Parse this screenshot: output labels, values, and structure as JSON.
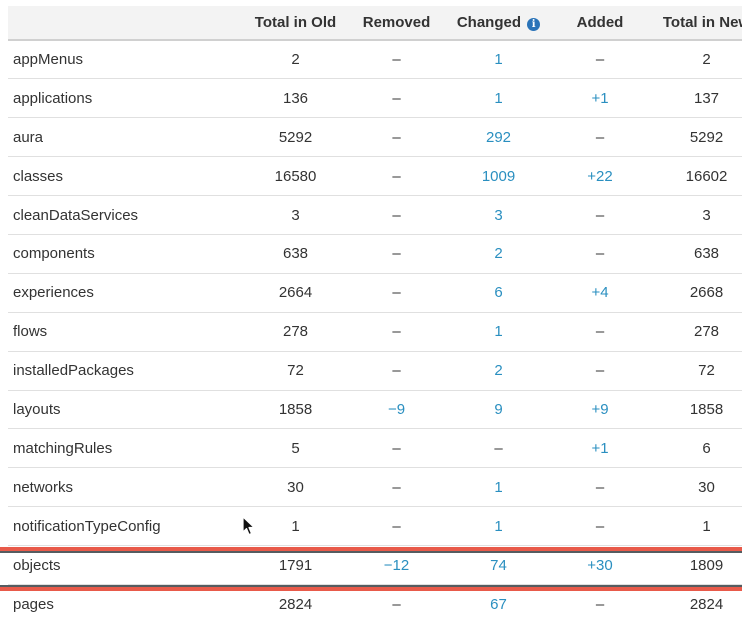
{
  "table": {
    "headers": {
      "name": "",
      "total_old": "Total in Old",
      "removed": "Removed",
      "changed": "Changed",
      "added": "Added",
      "total_new": "Total in New"
    },
    "rows": [
      {
        "name": "appMenus",
        "total_old": "2",
        "removed": "–",
        "changed": "1",
        "added": "–",
        "total_new": "2"
      },
      {
        "name": "applications",
        "total_old": "136",
        "removed": "–",
        "changed": "1",
        "added": "+1",
        "total_new": "137"
      },
      {
        "name": "aura",
        "total_old": "5292",
        "removed": "–",
        "changed": "292",
        "added": "–",
        "total_new": "5292"
      },
      {
        "name": "classes",
        "total_old": "16580",
        "removed": "–",
        "changed": "1009",
        "added": "+22",
        "total_new": "16602"
      },
      {
        "name": "cleanDataServices",
        "total_old": "3",
        "removed": "–",
        "changed": "3",
        "added": "–",
        "total_new": "3"
      },
      {
        "name": "components",
        "total_old": "638",
        "removed": "–",
        "changed": "2",
        "added": "–",
        "total_new": "638"
      },
      {
        "name": "experiences",
        "total_old": "2664",
        "removed": "–",
        "changed": "6",
        "added": "+4",
        "total_new": "2668"
      },
      {
        "name": "flows",
        "total_old": "278",
        "removed": "–",
        "changed": "1",
        "added": "–",
        "total_new": "278"
      },
      {
        "name": "installedPackages",
        "total_old": "72",
        "removed": "–",
        "changed": "2",
        "added": "–",
        "total_new": "72"
      },
      {
        "name": "layouts",
        "total_old": "1858",
        "removed": "−9",
        "changed": "9",
        "added": "+9",
        "total_new": "1858"
      },
      {
        "name": "matchingRules",
        "total_old": "5",
        "removed": "–",
        "changed": "–",
        "added": "+1",
        "total_new": "6"
      },
      {
        "name": "networks",
        "total_old": "30",
        "removed": "–",
        "changed": "1",
        "added": "–",
        "total_new": "30"
      },
      {
        "name": "notificationTypeConfig",
        "total_old": "1",
        "removed": "–",
        "changed": "1",
        "added": "–",
        "total_new": "1"
      },
      {
        "name": "objects",
        "total_old": "1791",
        "removed": "−12",
        "changed": "74",
        "added": "+30",
        "total_new": "1809"
      },
      {
        "name": "pages",
        "total_old": "2824",
        "removed": "–",
        "changed": "67",
        "added": "–",
        "total_new": "2824"
      }
    ],
    "highlighted_row": "objects"
  },
  "colors": {
    "link": "#2a8fc0",
    "info_icon": "#2a73b8",
    "highlight": "#e85a4a",
    "header_bg": "#f3f3f3"
  },
  "icons": {
    "changed_info": "info-icon",
    "pointer": "mouse-cursor-icon"
  }
}
